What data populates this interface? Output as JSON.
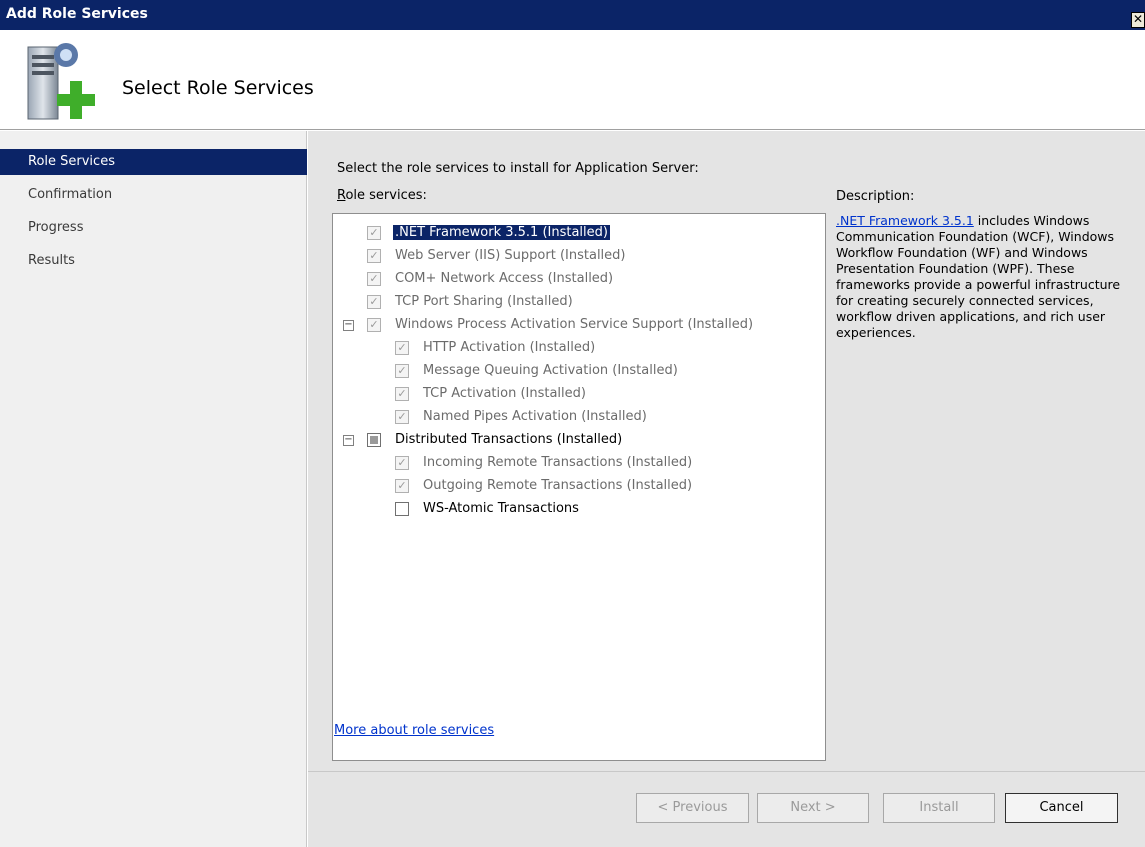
{
  "window": {
    "title": "Add Role Services",
    "close_glyph": "✕"
  },
  "header": {
    "title": "Select Role Services",
    "icon": "server-add-icon"
  },
  "sidebar": {
    "items": [
      {
        "label": "Role Services",
        "active": true
      },
      {
        "label": "Confirmation",
        "active": false
      },
      {
        "label": "Progress",
        "active": false
      },
      {
        "label": "Results",
        "active": false
      }
    ]
  },
  "main": {
    "instruction": "Select the role services to install for Application Server:",
    "role_services_label_accesskey": "R",
    "role_services_label_rest": "ole services:",
    "description_label": "Description:",
    "description_link": ".NET Framework 3.5.1",
    "description_text": " includes Windows Communication Foundation (WCF), Windows Workflow Foundation (WF) and Windows Presentation Foundation (WPF). These frameworks provide a powerful infrastructure for creating securely connected services, workflow driven applications, and rich user experiences.",
    "more_link": "More about role services"
  },
  "tree": [
    {
      "label": ".NET Framework 3.5.1  (Installed)",
      "state": "checked-disabled",
      "selected": true
    },
    {
      "label": "Web Server (IIS) Support  (Installed)",
      "state": "checked-disabled"
    },
    {
      "label": "COM+ Network Access  (Installed)",
      "state": "checked-disabled"
    },
    {
      "label": "TCP Port Sharing  (Installed)",
      "state": "checked-disabled"
    },
    {
      "label": "Windows Process Activation Service Support  (Installed)",
      "state": "checked-disabled",
      "expander": "⊟"
    },
    {
      "label": "HTTP Activation  (Installed)",
      "state": "checked-disabled"
    },
    {
      "label": "Message Queuing Activation  (Installed)",
      "state": "checked-disabled"
    },
    {
      "label": "TCP Activation  (Installed)",
      "state": "checked-disabled"
    },
    {
      "label": "Named Pipes Activation  (Installed)",
      "state": "checked-disabled"
    },
    {
      "label": "Distributed Transactions  (Installed)",
      "state": "partial",
      "expander": "⊟"
    },
    {
      "label": "Incoming Remote Transactions  (Installed)",
      "state": "checked-disabled"
    },
    {
      "label": "Outgoing Remote Transactions  (Installed)",
      "state": "checked-disabled"
    },
    {
      "label": "WS-Atomic Transactions",
      "state": "unchecked"
    }
  ],
  "buttons": {
    "previous": "< Previous",
    "next": "Next >",
    "install": "Install",
    "cancel": "Cancel"
  },
  "check_glyph": "✓"
}
